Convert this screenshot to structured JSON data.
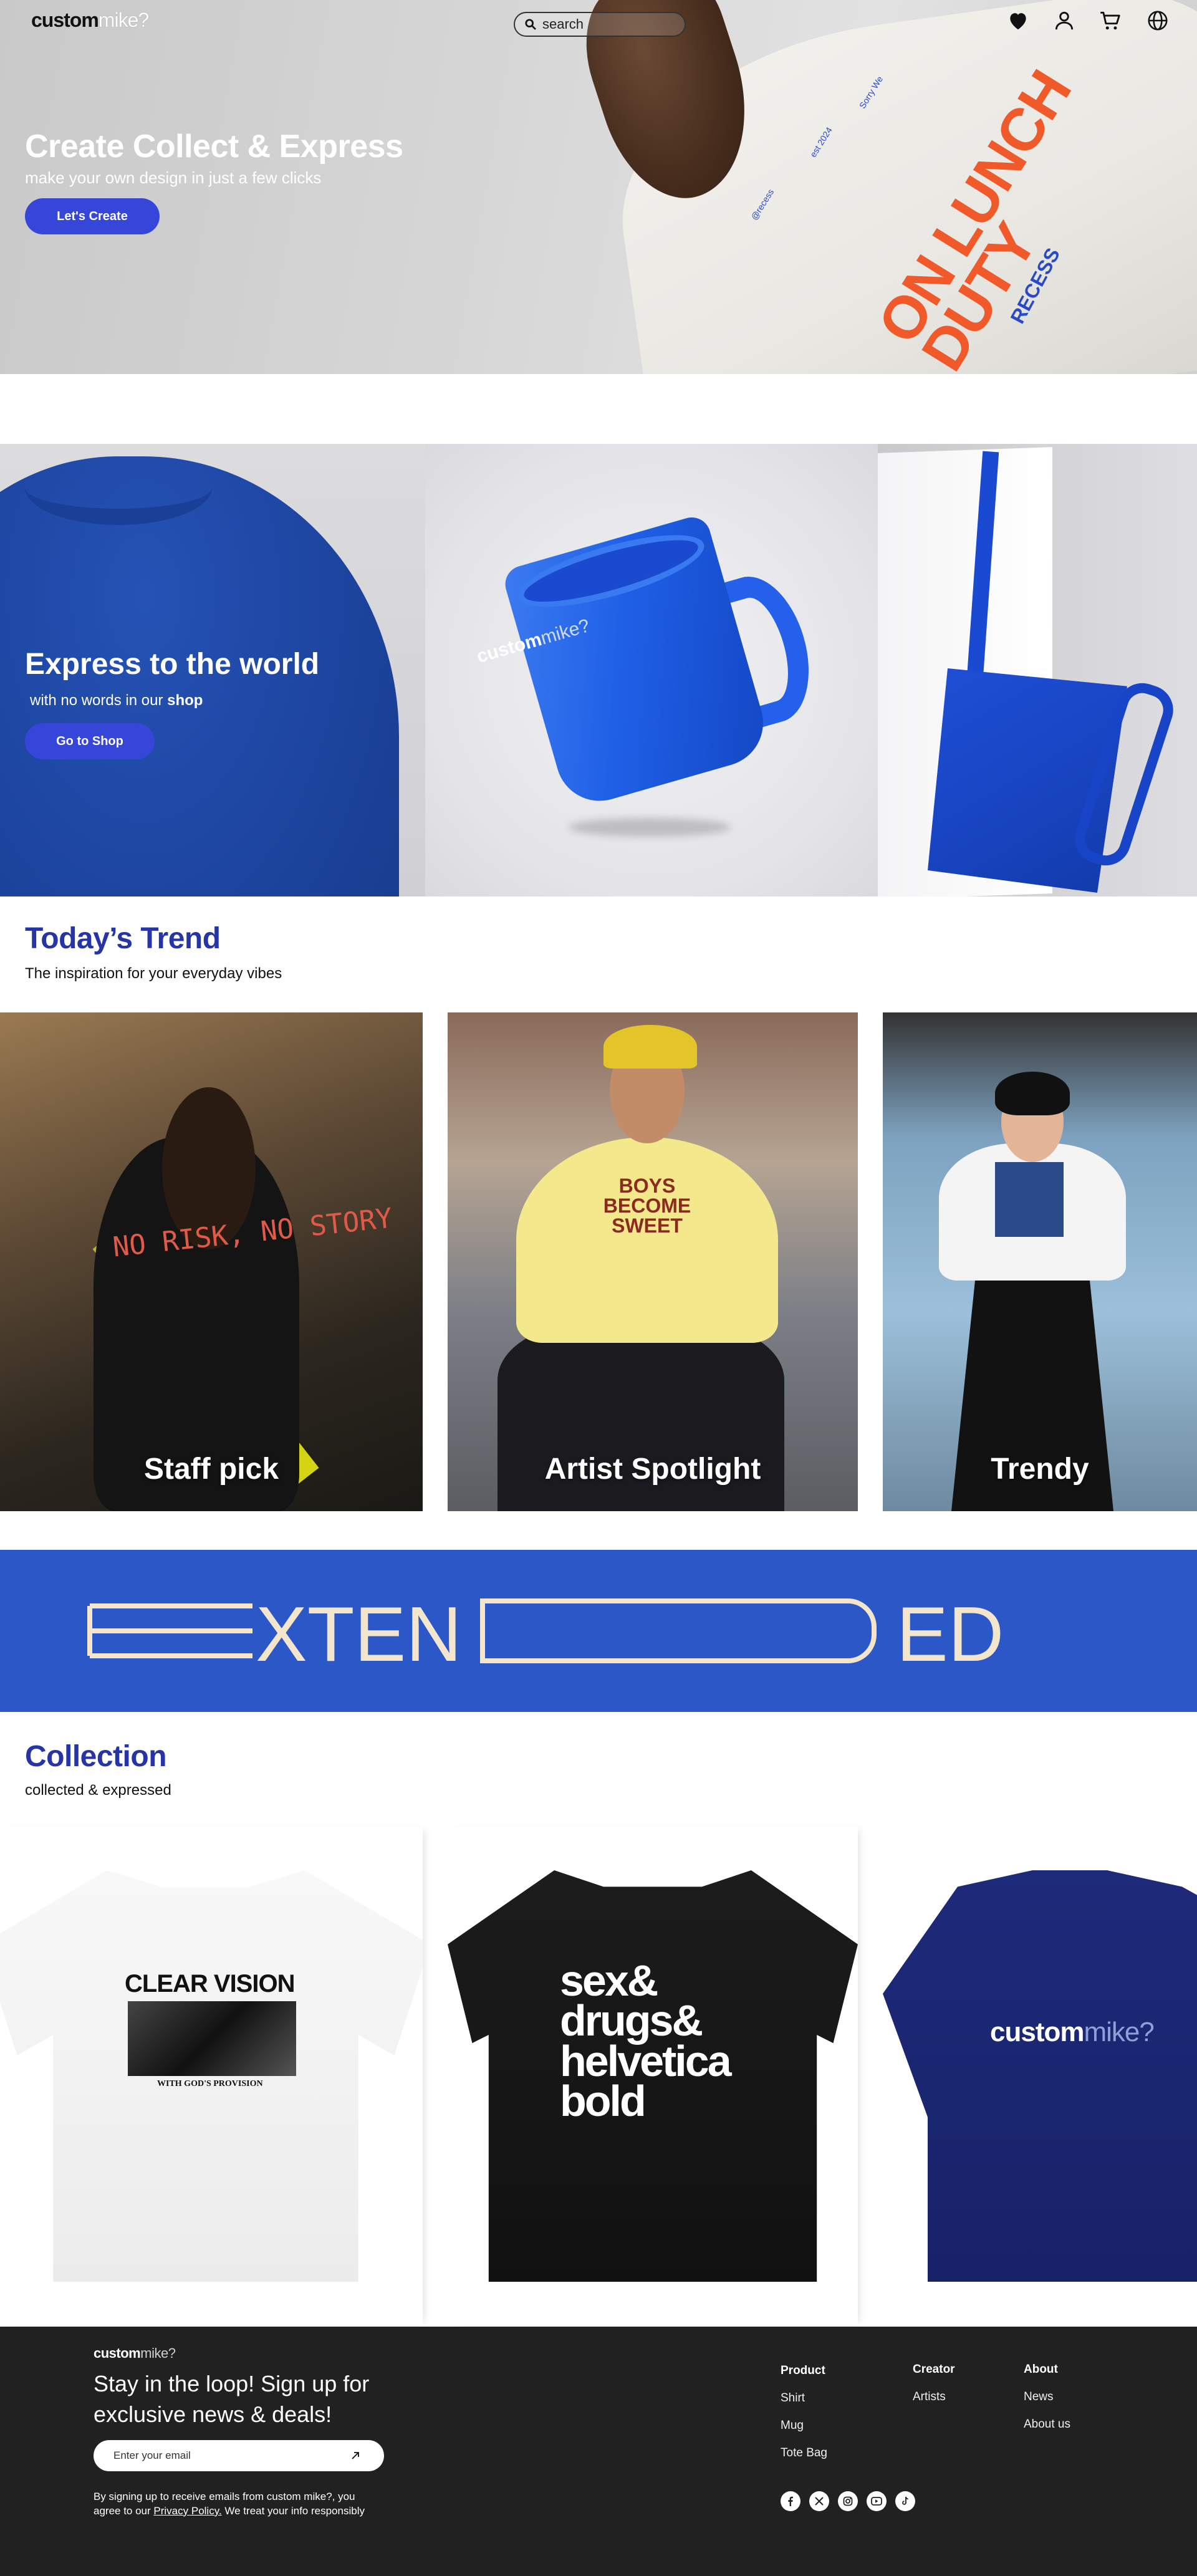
{
  "nav": {
    "logo_main": "custom",
    "logo_accent": "mike?",
    "search_placeholder": "search",
    "icons": [
      "heart-icon",
      "user-icon",
      "cart-icon",
      "globe-icon"
    ]
  },
  "hero": {
    "title": "Create Collect & Express",
    "subtitle": "make your own design in just a few clicks",
    "cta": "Let's Create",
    "shirt_print": "ON LUNCH DUTY",
    "shirt_brand": "RECESS",
    "shirt_small_1": "@recess",
    "shirt_small_2": "est 2024",
    "shirt_small_3": "Sorry We"
  },
  "express": {
    "title": "Express to the world",
    "subtitle_prefix": "with no words in our ",
    "subtitle_bold": "shop",
    "cta": "Go to Shop",
    "mug_logo_main": "custom",
    "mug_logo_accent": "mike?"
  },
  "trend": {
    "title": "Today’s Trend",
    "subtitle": "The inspiration for your everyday vibes",
    "cards": [
      {
        "label": "Staff pick",
        "print": "NO RISK, NO STORY"
      },
      {
        "label": "Artist Spotlight",
        "print": "BOYS BECOME SWEET"
      },
      {
        "label": "Trendy"
      }
    ]
  },
  "banner": {
    "text_left": "XTEN",
    "text_right": "ED"
  },
  "collection": {
    "title": "Collection",
    "subtitle": "collected & expressed",
    "products": [
      {
        "print_title": "CLEAR VISION",
        "print_sub": "WITH GOD'S PROVISION"
      },
      {
        "print_title": "sex& drugs& helvetica bold"
      },
      {
        "print_main": "custom",
        "print_accent": "mike?"
      }
    ]
  },
  "footer": {
    "logo_main": "custom",
    "logo_accent": "mike?",
    "title": "Stay in the loop! Sign up for exclusive news & deals!",
    "email_placeholder": "Enter your email",
    "legal_prefix": "By signing up to receive emails from custom mike?, you agree to our ",
    "legal_link": "Privacy Policy.",
    "legal_suffix": "  We treat your info responsibly",
    "columns": [
      {
        "heading": "Product",
        "links": [
          "Shirt",
          "Mug",
          "Tote Bag"
        ]
      },
      {
        "heading": "Creator",
        "links": [
          "Artists"
        ]
      },
      {
        "heading": "About",
        "links": [
          "News",
          "About us"
        ]
      }
    ],
    "socials": [
      "facebook-icon",
      "x-icon",
      "instagram-icon",
      "youtube-icon",
      "tiktok-icon"
    ]
  },
  "colors": {
    "primary": "#3546d9",
    "heading_blue": "#2535a8",
    "banner_blue": "#2c57c7",
    "footer_bg": "#212121"
  }
}
